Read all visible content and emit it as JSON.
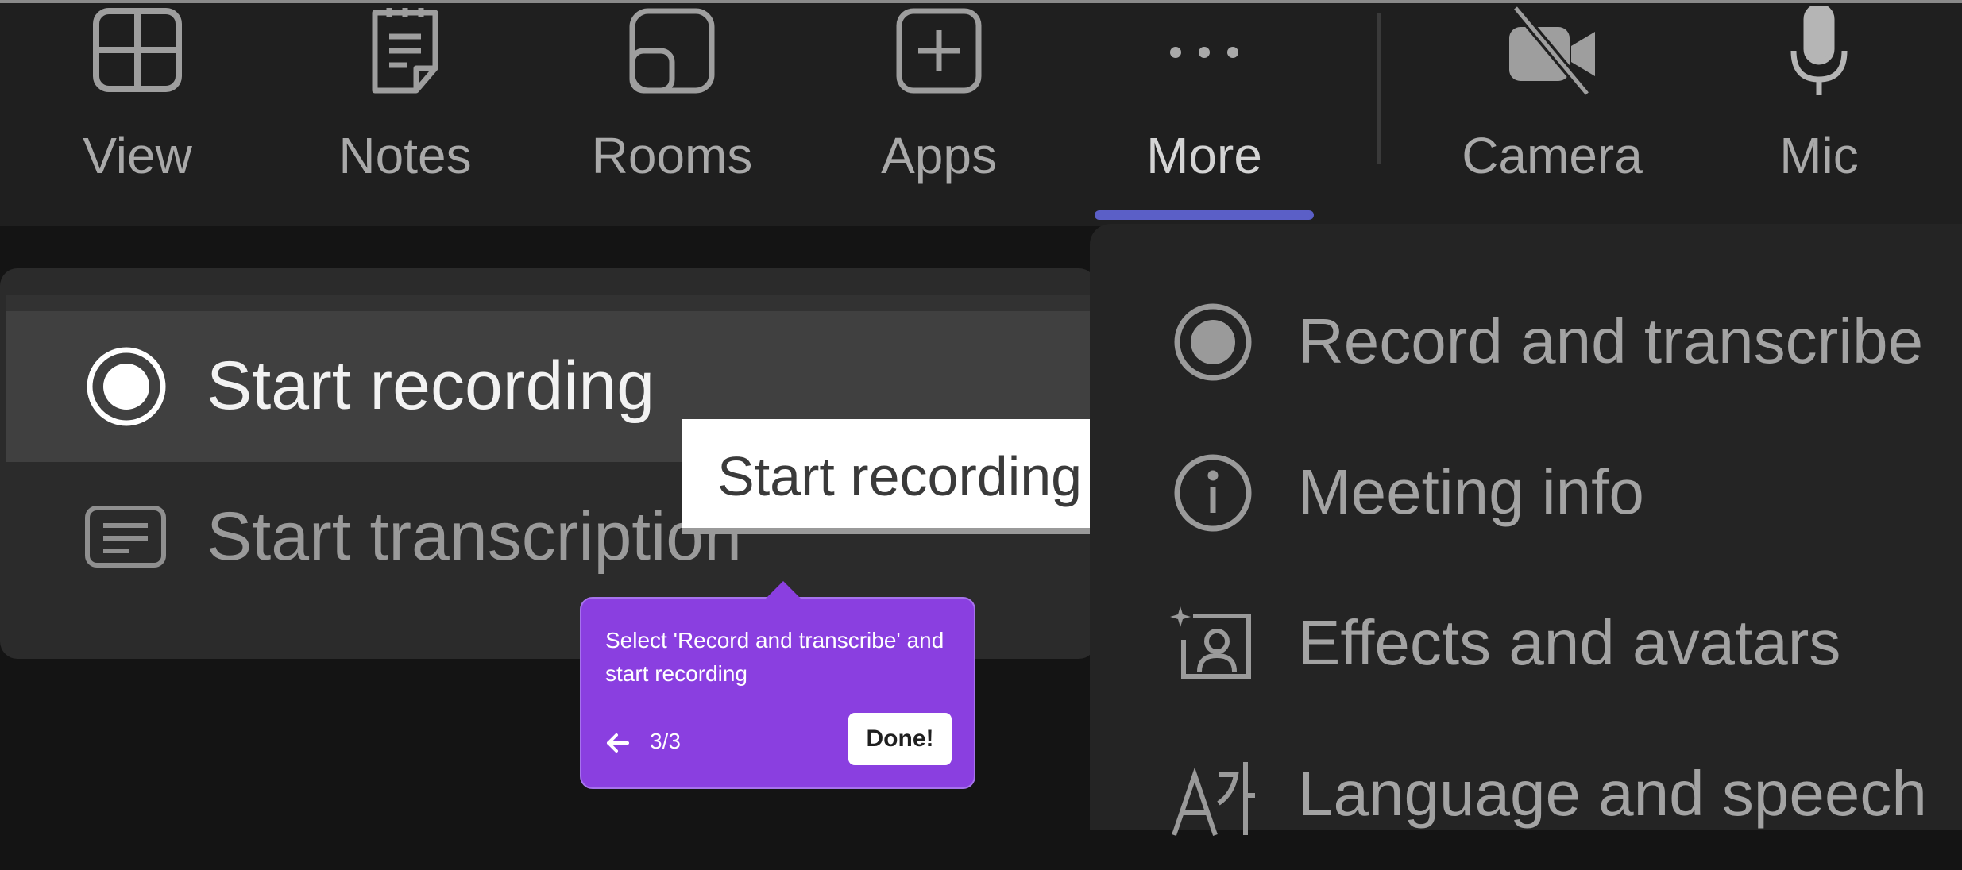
{
  "toolbar": {
    "buttons": [
      {
        "label": "View",
        "icon": "grid-view-icon"
      },
      {
        "label": "Notes",
        "icon": "notes-icon"
      },
      {
        "label": "Rooms",
        "icon": "breakout-rooms-icon"
      },
      {
        "label": "Apps",
        "icon": "add-app-icon"
      },
      {
        "label": "More",
        "icon": "more-dots-icon",
        "selected": true
      },
      {
        "label": "Camera",
        "icon": "camera-off-icon"
      },
      {
        "label": "Mic",
        "icon": "microphone-icon"
      }
    ],
    "accent_color": "#5b5fc7"
  },
  "recording_submenu": {
    "items": [
      {
        "label": "Start recording",
        "icon": "record-icon",
        "hovered": true
      },
      {
        "label": "Start transcription",
        "icon": "transcript-icon"
      }
    ]
  },
  "tooltip": {
    "text": "Start recording"
  },
  "coach_mark": {
    "message": "Select 'Record and transcribe' and start recording",
    "step": "3/3",
    "done_label": "Done!",
    "back_icon": "arrow-left-icon",
    "color": "#8a3fe0"
  },
  "more_menu": {
    "items": [
      {
        "label": "Record and transcribe",
        "icon": "record-icon"
      },
      {
        "label": "Meeting info",
        "icon": "info-icon"
      },
      {
        "label": "Effects and avatars",
        "icon": "effects-avatars-icon"
      },
      {
        "label": "Language and speech",
        "icon": "language-speech-icon"
      }
    ]
  }
}
